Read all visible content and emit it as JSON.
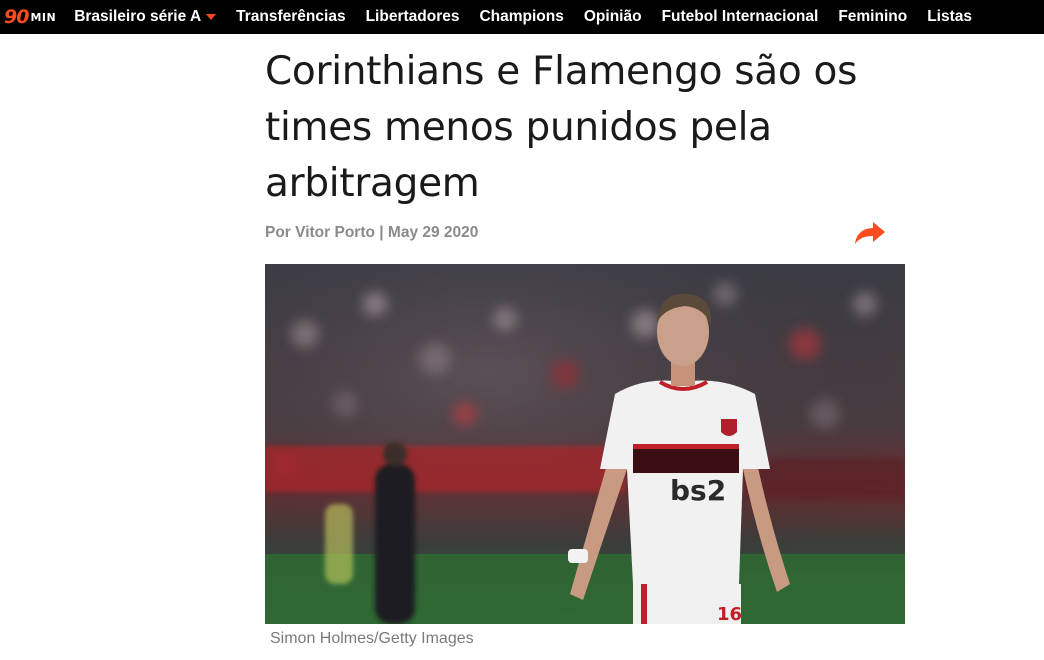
{
  "site": {
    "logo_number": "90",
    "logo_suffix": "MIN"
  },
  "nav": {
    "items": [
      {
        "label": "Brasileiro série A",
        "has_dropdown": true
      },
      {
        "label": "Transferências"
      },
      {
        "label": "Libertadores"
      },
      {
        "label": "Champions"
      },
      {
        "label": "Opinião"
      },
      {
        "label": "Futebol Internacional"
      },
      {
        "label": "Feminino"
      },
      {
        "label": "Listas"
      }
    ],
    "accent_color": "#ff4b1f"
  },
  "article": {
    "headline": "Corinthians e Flamengo são os times menos punidos pela arbitragem",
    "byline_author": "Por Vitor Porto",
    "byline_separator": "|",
    "byline_date": "May 29 2020",
    "share_icon": "share-arrow-icon",
    "image": {
      "jersey_text": "bs2",
      "jersey_number": "16"
    },
    "caption": "Simon Holmes/Getty Images"
  }
}
